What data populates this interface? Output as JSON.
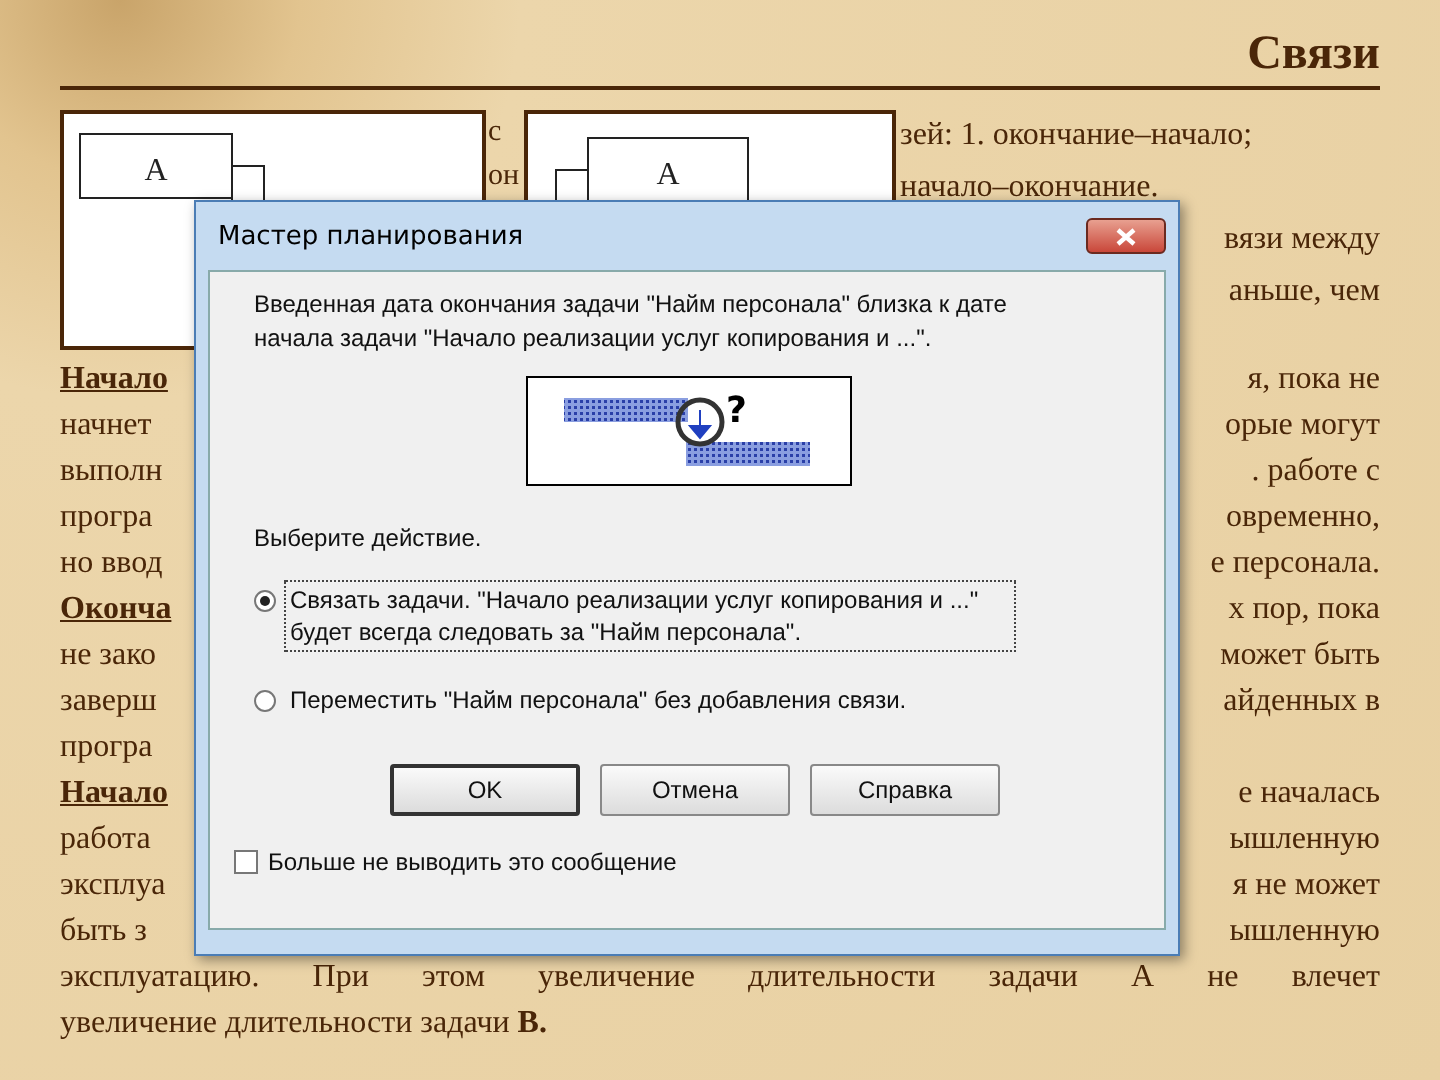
{
  "slide": {
    "title": "Связи",
    "diagrams": [
      {
        "label": "A",
        "kind": "finish"
      },
      {
        "label": "A",
        "kind": "start"
      }
    ],
    "middle_fragments": [
      "с",
      "он"
    ],
    "top_lines": [
      "зей: 1. окончание–начало;",
      "начало–окончание."
    ],
    "top_right_lines": [
      "вязи между",
      "аньше, чем"
    ],
    "lines": [
      {
        "left": "Начало",
        "left_underlined": true,
        "right": "я, пока не"
      },
      {
        "left": "начнет",
        "left_underlined": false,
        "right": "орые могут"
      },
      {
        "left": "выполн",
        "left_underlined": false,
        "right": ". работе с"
      },
      {
        "left": "програ",
        "left_underlined": false,
        "right": "овременно,"
      },
      {
        "left": "но ввод",
        "left_underlined": false,
        "right": "е персонала."
      },
      {
        "left": "Оконча",
        "left_underlined": true,
        "right": "х пор, пока"
      },
      {
        "left": "не зако",
        "left_underlined": false,
        "right": "может быть"
      },
      {
        "left": "заверш",
        "left_underlined": false,
        "right": "айденных в"
      },
      {
        "left": "програ",
        "left_underlined": false
      },
      {
        "left": "Начало",
        "left_underlined": true,
        "right": "е началась"
      },
      {
        "left": "работа",
        "left_underlined": false,
        "right": "ышленную"
      },
      {
        "left": "эксплуа",
        "left_underlined": false,
        "right": "я не может"
      },
      {
        "left": "быть з",
        "left_underlined": false,
        "right": "ышленную"
      }
    ],
    "closing_lines": [
      "эксплуатацию. При этом увеличение длительности задачи А не влечет",
      "увеличение длительности задачи **В.**"
    ]
  },
  "dialog": {
    "title": "Мастер планирования",
    "message": "Введенная дата окончания задачи \"Найм персонала\" близка к дате начала задачи \"Начало реализации услуг копирования и ...\".",
    "illustration_mark": "?",
    "prompt": "Выберите действие.",
    "options": [
      {
        "label": "Связать задачи. \"Начало реализации услуг копирования и ...\" будет всегда следовать за \"Найм персонала\".",
        "selected": true
      },
      {
        "label": "Переместить \"Найм персонала\" без добавления связи.",
        "selected": false
      }
    ],
    "buttons": [
      {
        "label": "OK",
        "default": true
      },
      {
        "label": "Отмена",
        "default": false
      },
      {
        "label": "Справка",
        "default": false
      }
    ],
    "dont_show": {
      "label": "Больше не выводить это сообщение",
      "checked": false
    }
  }
}
